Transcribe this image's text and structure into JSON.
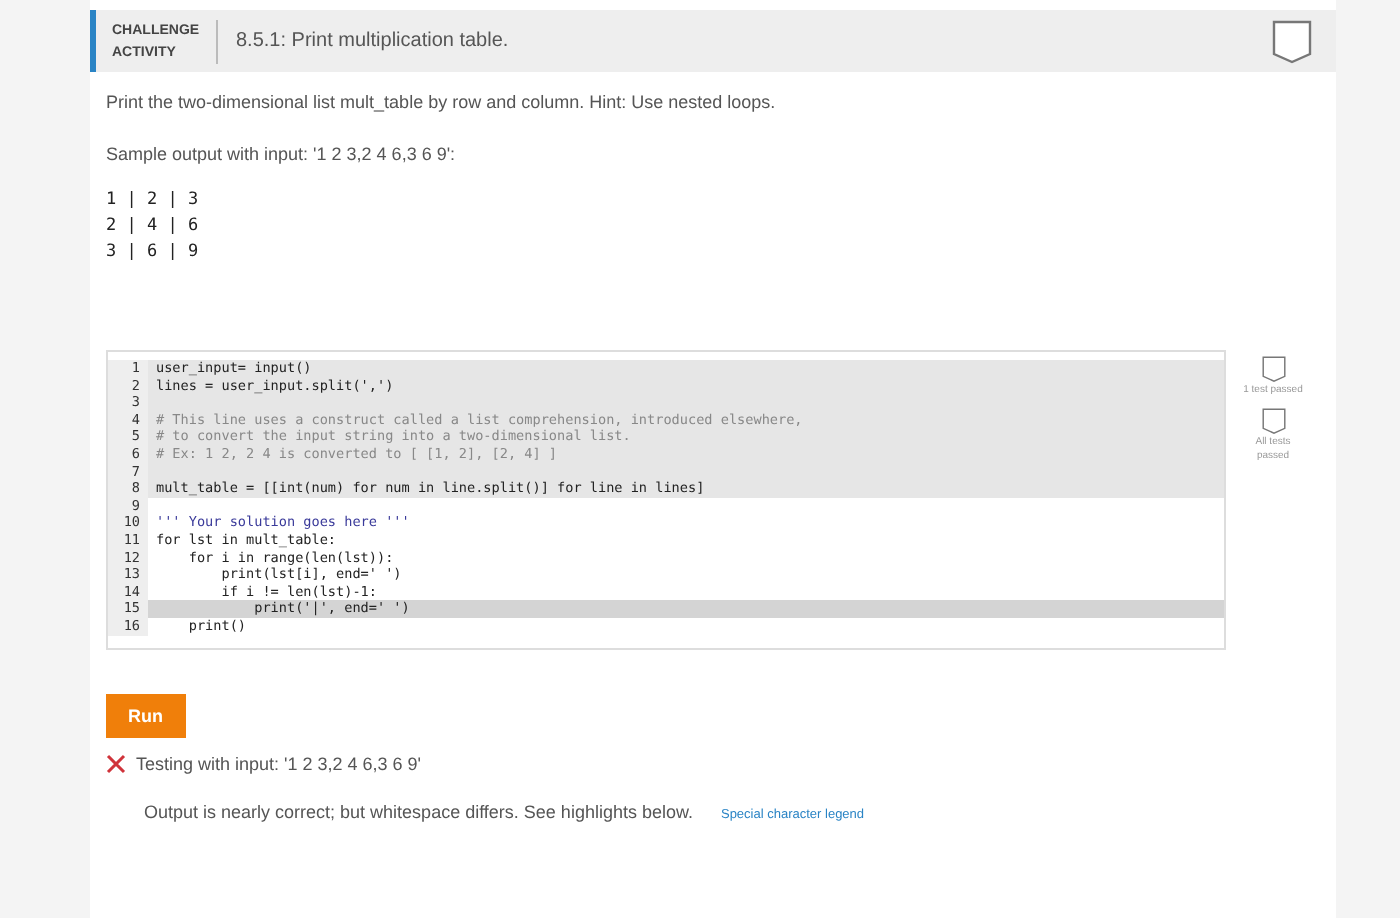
{
  "header": {
    "badge": "CHALLENGE ACTIVITY",
    "title": "8.5.1: Print multiplication table.",
    "completed": false
  },
  "prompt": "Print the two-dimensional list mult_table by row and column. Hint: Use nested loops.",
  "sample_label": "Sample output with input: '1 2 3,2 4 6,3 6 9':",
  "sample_output": [
    "1 | 2 | 3",
    "2 | 4 | 6",
    "3 | 6 | 9"
  ],
  "code_lines": [
    {
      "number": "1",
      "text": "user_input= input()",
      "kind": "code",
      "readonly": true,
      "selected": false
    },
    {
      "number": "2",
      "text": "lines = user_input.split(',')",
      "kind": "code",
      "readonly": true,
      "selected": false
    },
    {
      "number": "3",
      "readonly": true,
      "selected": false
    },
    {
      "number": "4",
      "text": "# This line uses a construct called a list comprehension, introduced elsewhere,",
      "kind": "comment",
      "readonly": true,
      "selected": false
    },
    {
      "number": "5",
      "text": "# to convert the input string into a two-dimensional list.",
      "kind": "comment",
      "readonly": true,
      "selected": false
    },
    {
      "number": "6",
      "text": "# Ex: 1 2, 2 4 is converted to [ [1, 2], [2, 4] ]",
      "kind": "comment",
      "readonly": true,
      "selected": false
    },
    {
      "number": "7",
      "readonly": true,
      "selected": false
    },
    {
      "number": "8",
      "text": "mult_table = [[int(num) for num in line.split()] for line in lines]",
      "kind": "code",
      "readonly": true,
      "selected": false
    },
    {
      "number": "9",
      "readonly": false,
      "selected": false
    },
    {
      "number": "10",
      "text": "''' Your solution goes here '''",
      "kind": "string",
      "readonly": false,
      "selected": false
    },
    {
      "number": "11",
      "text": "for lst in mult_table:",
      "kind": "code",
      "readonly": false,
      "selected": false
    },
    {
      "number": "12",
      "text": "    for i in range(len(lst)):",
      "kind": "code",
      "readonly": false,
      "selected": false
    },
    {
      "number": "13",
      "text": "        print(lst[i], end=' ')",
      "kind": "code",
      "readonly": false,
      "selected": false
    },
    {
      "number": "14",
      "text": "        if i != len(lst)-1:",
      "kind": "code",
      "readonly": false,
      "selected": false
    },
    {
      "number": "15",
      "text": "            print('|', end=' ')",
      "kind": "code",
      "readonly": false,
      "selected": true
    },
    {
      "number": "16",
      "text": "    print()",
      "kind": "code",
      "readonly": false,
      "selected": false
    }
  ],
  "tests": [
    {
      "label": "1 test passed",
      "passed": false
    },
    {
      "label": "All tests passed",
      "passed": false
    }
  ],
  "run_button": "Run",
  "result": {
    "passed": false,
    "label": "Testing with input: '1 2 3,2 4 6,3 6 9'",
    "message": "Output is nearly correct; but whitespace differs. See highlights below.",
    "link": "Special character legend"
  }
}
